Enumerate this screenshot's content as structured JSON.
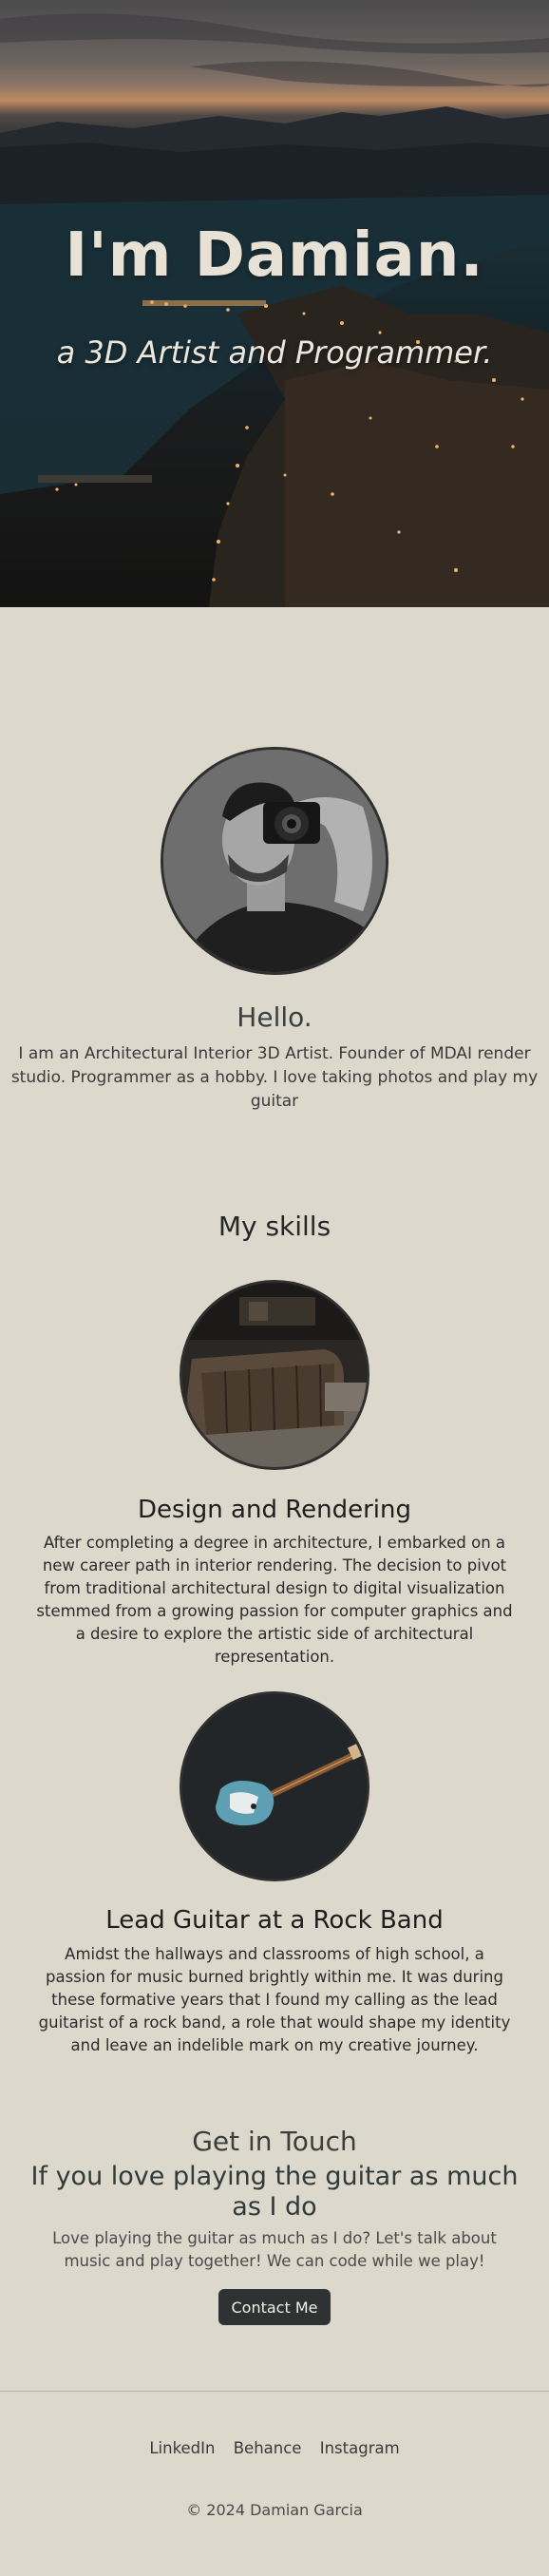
{
  "hero": {
    "title": "I'm Damian.",
    "subtitle": "a 3D Artist and Programmer."
  },
  "about": {
    "heading": "Hello.",
    "bio": "I am an Architectural Interior 3D Artist. Founder of MDAI render studio. Programmer as a hobby. I love taking photos and play my guitar"
  },
  "skills": {
    "heading": "My skills",
    "items": [
      {
        "title": "Design and Rendering",
        "description": "After completing a degree in architecture, I embarked on a new career path in interior rendering. The decision to pivot from traditional architectural design to digital visualization stemmed from a growing passion for computer graphics and a desire to explore the artistic side of architectural representation."
      },
      {
        "title": "Lead Guitar at a Rock Band",
        "description": "Amidst the hallways and classrooms of high school, a passion for music burned brightly within me. It was during these formative years that I found my calling as the lead guitarist of a rock band, a role that would shape my identity and leave an indelible mark on my creative journey."
      }
    ]
  },
  "contact": {
    "heading": "Get in Touch",
    "subheading": "If you love playing the guitar as much as I do",
    "text": "Love playing the guitar as much as I do? Let's talk about music and play together! We can code while we play!",
    "button_label": "Contact Me"
  },
  "footer": {
    "links": [
      "LinkedIn",
      "Behance",
      "Instagram"
    ],
    "copyright": "© 2024 Damian Garcia"
  }
}
